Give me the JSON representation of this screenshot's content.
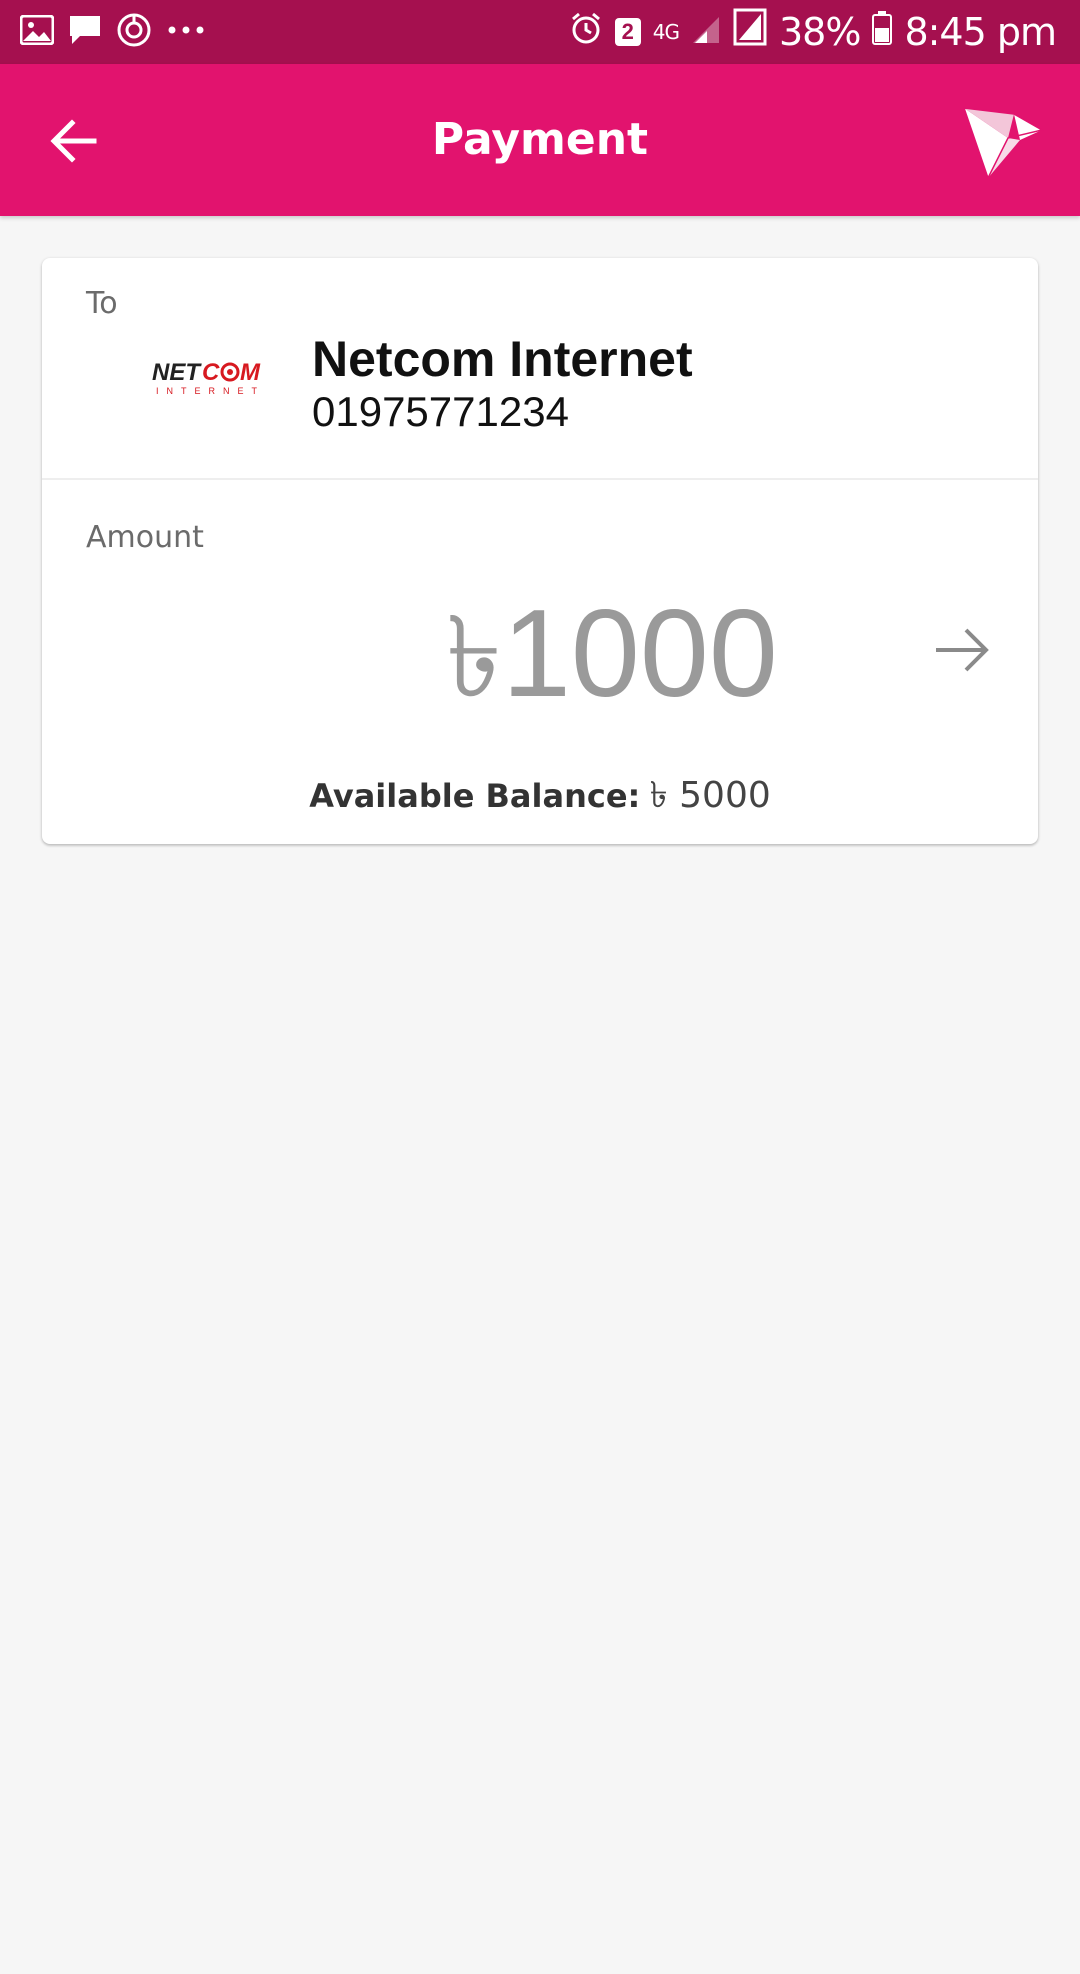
{
  "status_bar": {
    "left_icons": [
      "image-icon",
      "message-icon",
      "sync-icon",
      "more-dots-icon"
    ],
    "sim_badge": "2",
    "network": "4G",
    "battery_percent": "38%",
    "time": "8:45 pm"
  },
  "app_bar": {
    "title": "Payment",
    "back_icon": "arrow-left-icon",
    "logo_icon": "bkash-bird-icon"
  },
  "recipient": {
    "label": "To",
    "name": "Netcom Internet",
    "number": "01975771234",
    "logo_text": "NETCOM",
    "logo_subtext": "INTERNET"
  },
  "amount": {
    "label": "Amount",
    "currency_symbol": "৳",
    "value": "1000"
  },
  "balance": {
    "label": "Available Balance:",
    "value": "৳ 5000"
  },
  "colors": {
    "status_bar": "#a5104f",
    "app_bar": "#e2136e",
    "background": "#f6f6f6",
    "card": "#ffffff",
    "amount_text": "#9a9a9a",
    "netcom_red": "#d71920"
  }
}
